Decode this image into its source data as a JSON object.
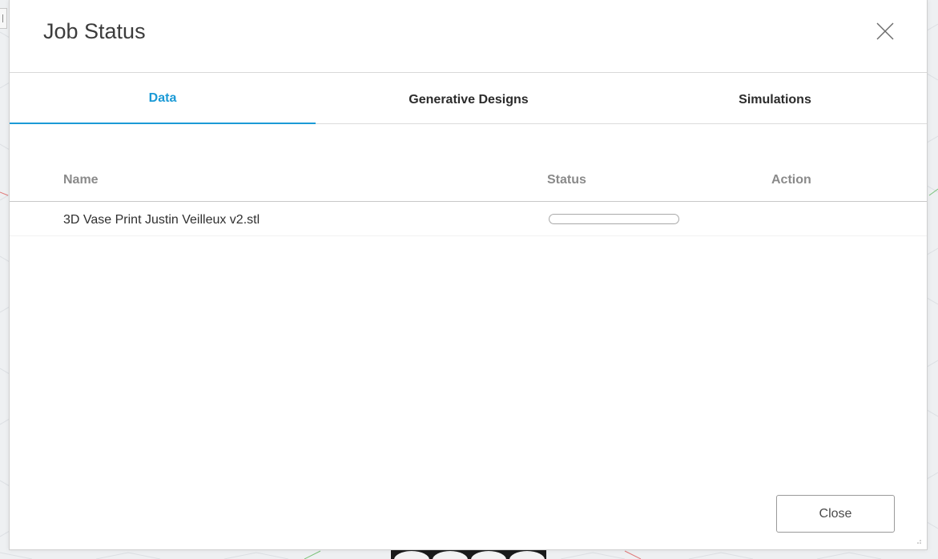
{
  "dialog": {
    "title": "Job Status",
    "close_icon": "close-icon"
  },
  "tabs": [
    {
      "label": "Data",
      "active": true
    },
    {
      "label": "Generative Designs",
      "active": false
    },
    {
      "label": "Simulations",
      "active": false
    }
  ],
  "table": {
    "columns": [
      "Name",
      "Status",
      "Action"
    ],
    "rows": [
      {
        "name": "3D Vase Print Justin Veilleux v2.stl",
        "progress": 0,
        "action": ""
      }
    ]
  },
  "footer": {
    "close_label": "Close"
  },
  "colors": {
    "accent": "#1b9ad6",
    "title": "#3c3c3c",
    "header_text": "#8a8a8a"
  }
}
